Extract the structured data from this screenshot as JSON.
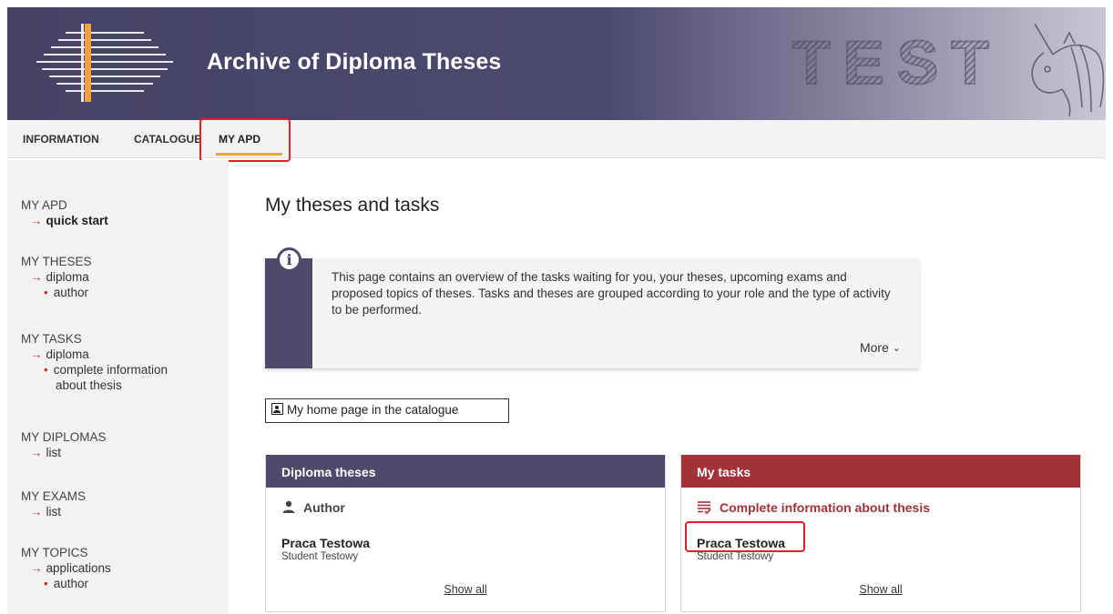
{
  "header": {
    "title": "Archive of Diploma Theses",
    "watermark": "TEST"
  },
  "nav": {
    "items": [
      "INFORMATION",
      "CATALOGUE",
      "MY APD"
    ],
    "active": "MY APD"
  },
  "sidebar": {
    "groups": [
      {
        "head": "MY APD",
        "items": [
          {
            "level": 1,
            "label": "quick start",
            "bold": true
          }
        ]
      },
      {
        "head": "MY THESES",
        "items": [
          {
            "level": 1,
            "label": "diploma"
          },
          {
            "level": 2,
            "label": "author"
          }
        ]
      },
      {
        "head": "MY TASKS",
        "items": [
          {
            "level": 1,
            "label": "diploma"
          },
          {
            "level": 2,
            "label": "complete information",
            "cont": "about thesis"
          }
        ]
      },
      {
        "head": "MY DIPLOMAS",
        "items": [
          {
            "level": 1,
            "label": "list"
          }
        ]
      },
      {
        "head": "MY EXAMS",
        "items": [
          {
            "level": 1,
            "label": "list"
          }
        ]
      },
      {
        "head": "MY TOPICS",
        "items": [
          {
            "level": 1,
            "label": "applications"
          },
          {
            "level": 2,
            "label": "author"
          }
        ]
      }
    ]
  },
  "main": {
    "title": "My theses and tasks",
    "info_text": "This page contains an overview of the tasks waiting for you, your theses, upcoming exams and proposed topics of theses. Tasks and theses are grouped according to your role and the type of activity to be performed.",
    "info_more": "More",
    "home_button": "My home page in the catalogue"
  },
  "cards": [
    {
      "title": "Diploma theses",
      "subtitle": "Author",
      "thesis": "Praca Testowa",
      "student": "Student Testowy",
      "link": "Show all"
    },
    {
      "title": "My tasks",
      "subtitle": "Complete information about thesis",
      "thesis": "Praca Testowa",
      "student": "Student Testowy",
      "link": "Show all"
    }
  ],
  "colors": {
    "header": "#4d4a6c",
    "tasks": "#a23238",
    "accent": "#f0a23c",
    "highlight": "#e01f26"
  }
}
